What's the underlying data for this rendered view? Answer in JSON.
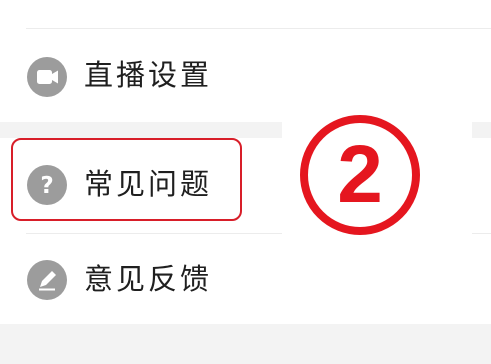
{
  "menu": {
    "items": [
      {
        "label": "直播设置",
        "icon": "video-camera-icon"
      },
      {
        "label": "常见问题",
        "icon": "question-mark-icon"
      },
      {
        "label": "意见反馈",
        "icon": "pencil-icon"
      }
    ]
  },
  "annotation": {
    "marker": "2",
    "color": "#e5161f"
  }
}
